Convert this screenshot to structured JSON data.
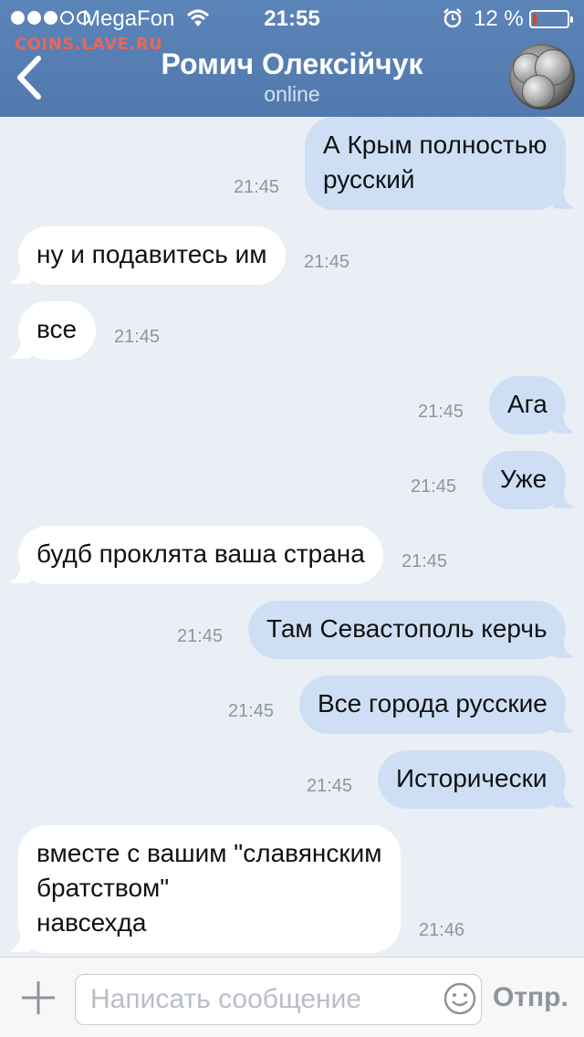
{
  "status_bar": {
    "carrier": "MegaFon",
    "time": "21:55",
    "battery_percent_label": "12 %",
    "battery_level": 0.12,
    "battery_color": "#e3412f",
    "signal_bars_filled": 3,
    "signal_bars_total": 5,
    "icons": [
      "wifi-icon",
      "alarm-icon",
      "battery-icon"
    ]
  },
  "watermark": "COINS.LAVE.RU",
  "header": {
    "back_icon": "chevron-left-icon",
    "contact_name": "Ромич Олексійчук",
    "contact_status": "online",
    "avatar_description_icon": "coins-avatar"
  },
  "colors": {
    "header": "#5279ad",
    "incoming_bubble": "#ffffff",
    "outgoing_bubble": "#cedff5",
    "background": "#eaeff6"
  },
  "messages": [
    {
      "dir": "out",
      "lines": [
        "А Крым полностью",
        "русский"
      ],
      "time": "21:45"
    },
    {
      "dir": "in",
      "lines": [
        "ну и подавитесь им"
      ],
      "time": "21:45"
    },
    {
      "dir": "in",
      "lines": [
        "все"
      ],
      "time": "21:45"
    },
    {
      "dir": "out",
      "lines": [
        "Ага"
      ],
      "time": "21:45"
    },
    {
      "dir": "out",
      "lines": [
        "Уже"
      ],
      "time": "21:45"
    },
    {
      "dir": "in",
      "lines": [
        "будб проклята ваша страна"
      ],
      "time": "21:45"
    },
    {
      "dir": "out",
      "lines": [
        "Там Севастополь керчь"
      ],
      "time": "21:45"
    },
    {
      "dir": "out",
      "lines": [
        "Все города русские"
      ],
      "time": "21:45"
    },
    {
      "dir": "out",
      "lines": [
        "Исторически"
      ],
      "time": "21:45"
    },
    {
      "dir": "in",
      "lines": [
        "вместе с вашим \"славянским",
        "братством\"",
        "навсехда"
      ],
      "time": "21:46"
    }
  ],
  "composer": {
    "attach_icon": "plus-icon",
    "placeholder": "Написать сообщение",
    "emoji_icon": "smile-icon",
    "send_label": "Отпр."
  }
}
